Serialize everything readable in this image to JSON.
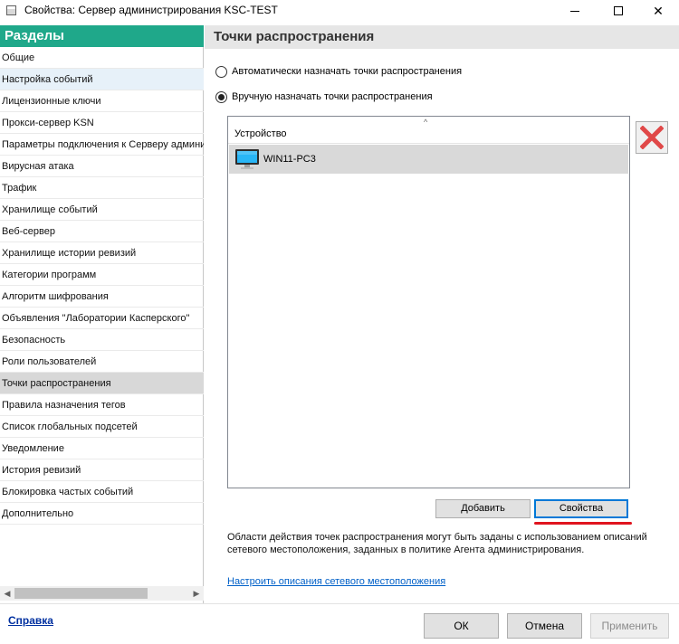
{
  "window": {
    "title": "Свойства: Сервер администрирования KSC-TEST",
    "close_glyph": "✕"
  },
  "sidebar": {
    "header": "Разделы",
    "items": [
      {
        "label": "Общие"
      },
      {
        "label": "Настройка событий"
      },
      {
        "label": "Лицензионные ключи"
      },
      {
        "label": "Прокси-сервер KSN"
      },
      {
        "label": "Параметры подключения к Серверу админи"
      },
      {
        "label": "Вирусная атака"
      },
      {
        "label": "Трафик"
      },
      {
        "label": "Хранилище событий"
      },
      {
        "label": "Веб-сервер"
      },
      {
        "label": "Хранилище истории ревизий"
      },
      {
        "label": "Категории программ"
      },
      {
        "label": "Алгоритм шифрования"
      },
      {
        "label": "Объявления \"Лаборатории Касперского\""
      },
      {
        "label": "Безопасность"
      },
      {
        "label": "Роли пользователей"
      },
      {
        "label": "Точки распространения"
      },
      {
        "label": "Правила назначения тегов"
      },
      {
        "label": "Список глобальных подсетей"
      },
      {
        "label": "Уведомление"
      },
      {
        "label": "История ревизий"
      },
      {
        "label": "Блокировка частых событий"
      },
      {
        "label": "Дополнительно"
      }
    ],
    "selected_index": 15,
    "hover_index": 1
  },
  "main": {
    "section_title": "Точки распространения",
    "radio_auto": {
      "label": "Автоматически назначать точки распространения",
      "checked": false
    },
    "radio_manual": {
      "label": "Вручную назначать точки распространения",
      "checked": true
    },
    "list": {
      "column_header": "Устройство",
      "sort_glyph": "^",
      "rows": [
        {
          "name": "WIN11-PC3"
        }
      ]
    },
    "add_button": "Добавить",
    "properties_button": "Свойства",
    "note": "Области действия точек распространения могут быть заданы с использованием описаний сетевого местоположения, заданных в политике Агента администрирования.",
    "link": "Настроить описания сетевого местоположения"
  },
  "footer": {
    "help": "Справка",
    "ok": "ОК",
    "cancel": "Отмена",
    "apply": "Применить"
  },
  "colors": {
    "sidebar_header": "#1fa88a",
    "highlight_underline": "#e0141e",
    "delete_icon": "#e04848"
  }
}
